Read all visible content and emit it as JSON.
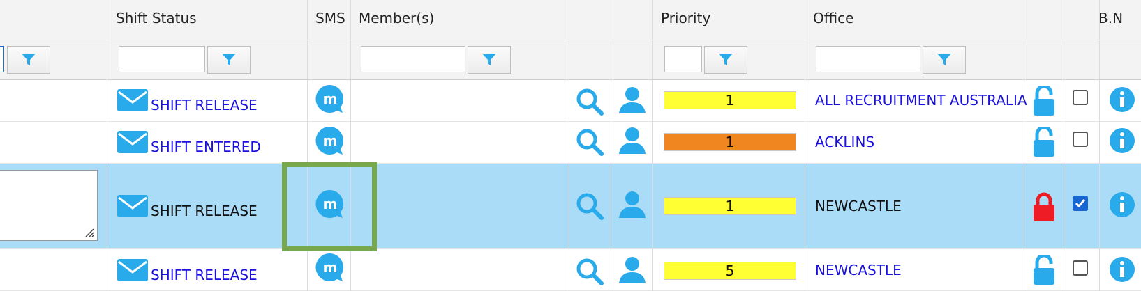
{
  "headers": {
    "shift_status": "Shift Status",
    "sms": "SMS",
    "members": "Member(s)",
    "priority": "Priority",
    "office": "Office",
    "bn": "B.N"
  },
  "colors": {
    "header_bg": "#f3f3f3",
    "selected_row": "#abdcf7",
    "link": "#1a10e0",
    "icon_blue": "#29aaeb",
    "priority_yellow": "#ffff33",
    "priority_orange": "#f0861f",
    "lock_red": "#ee1c24",
    "highlight_green": "#77a84f"
  },
  "rows": [
    {
      "status": "SHIFT RELEASE",
      "priority": "1",
      "priority_color": "yellow",
      "office": "ALL RECRUITMENT AUSTRALIA",
      "locked": false,
      "checked": false,
      "selected": false
    },
    {
      "status": "SHIFT ENTERED",
      "priority": "1",
      "priority_color": "orange",
      "office": "ACKLINS",
      "locked": false,
      "checked": false,
      "selected": false
    },
    {
      "status": "SHIFT RELEASE",
      "priority": "1",
      "priority_color": "yellow",
      "office": "NEWCASTLE",
      "locked": true,
      "checked": true,
      "selected": true
    },
    {
      "status": "SHIFT RELEASE",
      "priority": "5",
      "priority_color": "yellow",
      "office": "NEWCASTLE",
      "locked": false,
      "checked": false,
      "selected": false
    }
  ]
}
